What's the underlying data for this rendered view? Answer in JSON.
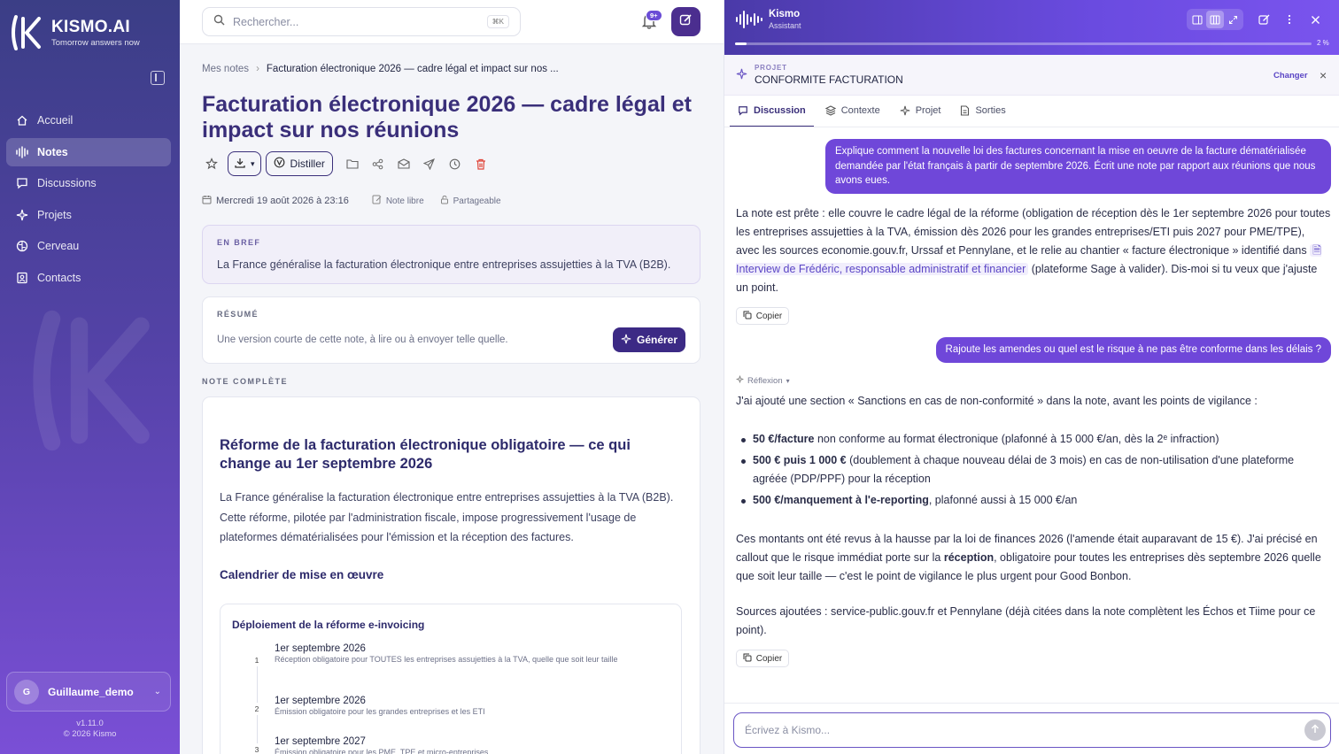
{
  "brand": {
    "name": "KISMO.AI",
    "tagline": "Tomorrow answers now"
  },
  "sidebar": {
    "items": [
      {
        "label": "Accueil",
        "icon": "home-icon"
      },
      {
        "label": "Notes",
        "icon": "waveform-icon",
        "active": true
      },
      {
        "label": "Discussions",
        "icon": "chat-icon"
      },
      {
        "label": "Projets",
        "icon": "sparkle-icon"
      },
      {
        "label": "Cerveau",
        "icon": "brain-icon"
      },
      {
        "label": "Contacts",
        "icon": "contact-card-icon"
      }
    ],
    "user": {
      "initial": "G",
      "name": "Guillaume_demo"
    },
    "version": "v1.11.0",
    "copyright": "© 2026 Kismo"
  },
  "topbar": {
    "search_placeholder": "Rechercher...",
    "shortcut": "⌘K",
    "notification_badge": "9+"
  },
  "note": {
    "breadcrumb": {
      "root": "Mes notes",
      "current": "Facturation électronique 2026 — cadre légal et impact sur nos ..."
    },
    "title": "Facturation électronique 2026 — cadre légal et impact sur nos réunions",
    "distill_label": "Distiller",
    "date": "Mercredi 19 août 2026 à 23:16",
    "type": "Note libre",
    "sharing": "Partageable",
    "brief": {
      "label": "EN BREF",
      "text": "La France généralise la facturation électronique entre entreprises assujetties à la TVA (B2B)."
    },
    "summary": {
      "label": "RÉSUMÉ",
      "text": "Une version courte de cette note, à lire ou à envoyer telle quelle.",
      "button": "Générer"
    },
    "full_label": "NOTE COMPLÈTE",
    "content": {
      "heading": "Réforme de la facturation électronique obligatoire — ce qui change au 1er septembre 2026",
      "paragraph": "La France généralise la facturation électronique entre entreprises assujetties à la TVA (B2B). Cette réforme, pilotée par l'administration fiscale, impose progressivement l'usage de plateformes dématérialisées pour l'émission et la réception des factures.",
      "subheading": "Calendrier de mise en œuvre",
      "timeline": {
        "title": "Déploiement de la réforme e-invoicing",
        "items": [
          {
            "num": "1",
            "date": "1er septembre 2026",
            "desc": "Réception obligatoire pour TOUTES les entreprises assujetties à la TVA, quelle que soit leur taille"
          },
          {
            "num": "2",
            "date": "1er septembre 2026",
            "desc": "Émission obligatoire pour les grandes entreprises et les ETI"
          },
          {
            "num": "3",
            "date": "1er septembre 2027",
            "desc": "Émission obligatoire pour les PME, TPE et micro-entreprises"
          }
        ]
      }
    }
  },
  "chat": {
    "name": "Kismo",
    "subtitle": "Assistant",
    "progress_label": "2 %",
    "progress": 0.02,
    "project_label": "PROJET",
    "project_name": "CONFORMITE FACTURATION",
    "change_label": "Changer",
    "tabs": [
      {
        "label": "Discussion",
        "active": true
      },
      {
        "label": "Contexte"
      },
      {
        "label": "Projet"
      },
      {
        "label": "Sorties"
      }
    ],
    "messages": {
      "user1": "Explique comment la nouvelle loi des factures concernant la mise en oeuvre de la facture dématérialisée demandée par l'état français à partir de septembre 2026. Écrit une note par rapport aux réunions que nous avons eues.",
      "assistant1_before": "La note est prête : elle couvre le cadre légal de la réforme (obligation de réception dès le 1er septembre 2026 pour toutes les entreprises assujetties à la TVA, émission dès 2026 pour les grandes entreprises/ETI puis 2027 pour PME/TPE), avec les sources economie.gouv.fr, Urssaf et Pennylane, et le relie au chantier « facture électronique » identifié dans ",
      "assistant1_link": "Interview de Frédéric, responsable administratif et financier",
      "assistant1_after": " (plateforme Sage à valider). Dis-moi si tu veux que j'ajuste un point.",
      "copy": "Copier",
      "user2": "Rajoute les amendes ou quel est le risque à ne pas être conforme dans les délais ?",
      "reflexion": "Réflexion",
      "assistant2_intro": "J'ai ajouté une section « Sanctions en cas de non-conformité » dans la note, avant les points de vigilance :",
      "bullets": [
        {
          "bold": "50 €/facture",
          "rest": " non conforme au format électronique (plafonné à 15 000 €/an, dès la 2ᵉ infraction)"
        },
        {
          "bold": "500 € puis 1 000 €",
          "rest": " (doublement à chaque nouveau délai de 3 mois) en cas de non-utilisation d'une plateforme agréée (PDP/PPF) pour la réception"
        },
        {
          "bold": "500 €/manquement à l'e-reporting",
          "rest": ", plafonné aussi à 15 000 €/an"
        }
      ],
      "para2_before": "Ces montants ont été revus à la hausse par la loi de finances 2026 (l'amende était auparavant de 15 €). J'ai précisé en callout que le risque immédiat porte sur la ",
      "para2_bold": "réception",
      "para2_after": ", obligatoire pour toutes les entreprises dès septembre 2026 quelle que soit leur taille — c'est le point de vigilance le plus urgent pour Good Bonbon.",
      "para3": "Sources ajoutées : service-public.gouv.fr et Pennylane (déjà citées dans la note complètent les Échos et Tiime pour ce point)."
    },
    "input_placeholder": "Écrivez à Kismo..."
  }
}
